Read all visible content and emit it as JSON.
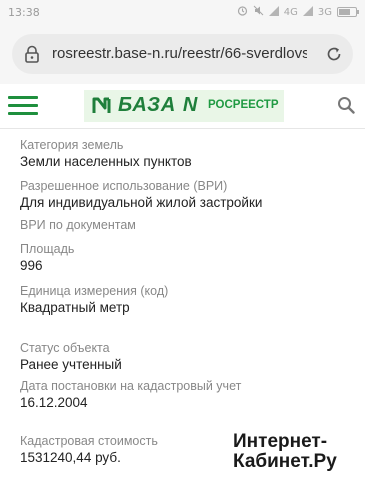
{
  "status_bar": {
    "time": "13:38",
    "network": "4G",
    "network2": "3G",
    "icons": [
      "alarm-icon",
      "mute-icon",
      "signal-icon",
      "signal-icon",
      "battery-icon"
    ],
    "battery_level": 0.7
  },
  "browser": {
    "url": "rosreestr.base-n.ru/reestr/66-sverdlovsk"
  },
  "header": {
    "logo_text": "БАЗА N",
    "logo_sub": "РОСРЕЕСТР",
    "accent_color": "#1e8f3d",
    "band_color": "#e9f6e7"
  },
  "fields": [
    {
      "label": "Категория земель",
      "value": "Земли населенных пунктов"
    },
    {
      "label": "Разрешенное использование (ВРИ)",
      "value": "Для индивидуальной жилой застройки"
    },
    {
      "label": "ВРИ по документам",
      "value": ""
    },
    {
      "label": "Площадь",
      "value": "996"
    },
    {
      "label": "Единица измерения (код)",
      "value": "Квадратный метр"
    },
    {
      "label": "Статус объекта",
      "value": "Ранее учтенный"
    },
    {
      "label": "Дата постановки на кадастровый учет",
      "value": "16.12.2004"
    },
    {
      "label": "Кадастровая стоимость",
      "value": "1531240,44 руб."
    }
  ],
  "watermark": {
    "line1": "Интернет-",
    "line2": "Кабинет.Ру"
  }
}
